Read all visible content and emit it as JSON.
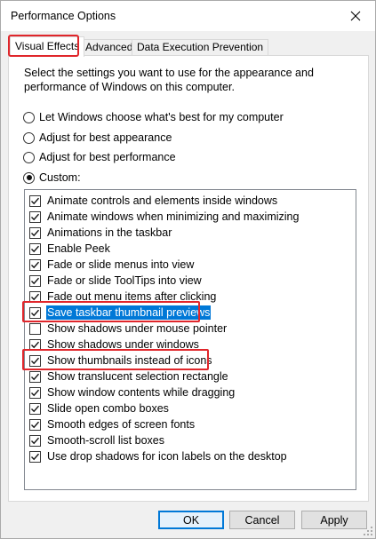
{
  "window": {
    "title": "Performance Options"
  },
  "tabs": [
    {
      "label": "Visual Effects",
      "active": true
    },
    {
      "label": "Advanced",
      "active": false
    },
    {
      "label": "Data Execution Prevention",
      "active": false
    }
  ],
  "description": "Select the settings you want to use for the appearance and performance of Windows on this computer.",
  "radio_options": [
    {
      "label": "Let Windows choose what's best for my computer",
      "checked": false
    },
    {
      "label": "Adjust for best appearance",
      "checked": false
    },
    {
      "label": "Adjust for best performance",
      "checked": false
    },
    {
      "label": "Custom:",
      "checked": true
    }
  ],
  "effects": [
    {
      "label": "Animate controls and elements inside windows",
      "checked": true
    },
    {
      "label": "Animate windows when minimizing and maximizing",
      "checked": true
    },
    {
      "label": "Animations in the taskbar",
      "checked": true
    },
    {
      "label": "Enable Peek",
      "checked": true
    },
    {
      "label": "Fade or slide menus into view",
      "checked": true
    },
    {
      "label": "Fade or slide ToolTips into view",
      "checked": true
    },
    {
      "label": "Fade out menu items after clicking",
      "checked": true
    },
    {
      "label": "Save taskbar thumbnail previews",
      "checked": true,
      "selected": true
    },
    {
      "label": "Show shadows under mouse pointer",
      "checked": false
    },
    {
      "label": "Show shadows under windows",
      "checked": true
    },
    {
      "label": "Show thumbnails instead of icons",
      "checked": true
    },
    {
      "label": "Show translucent selection rectangle",
      "checked": true
    },
    {
      "label": "Show window contents while dragging",
      "checked": true
    },
    {
      "label": "Slide open combo boxes",
      "checked": true
    },
    {
      "label": "Smooth edges of screen fonts",
      "checked": true
    },
    {
      "label": "Smooth-scroll list boxes",
      "checked": true
    },
    {
      "label": "Use drop shadows for icon labels on the desktop",
      "checked": true
    }
  ],
  "buttons": {
    "ok": "OK",
    "cancel": "Cancel",
    "apply": "Apply"
  },
  "colors": {
    "highlight_box": "#e0262b",
    "selection": "#0078d7",
    "default_button_border": "#0078d7"
  }
}
